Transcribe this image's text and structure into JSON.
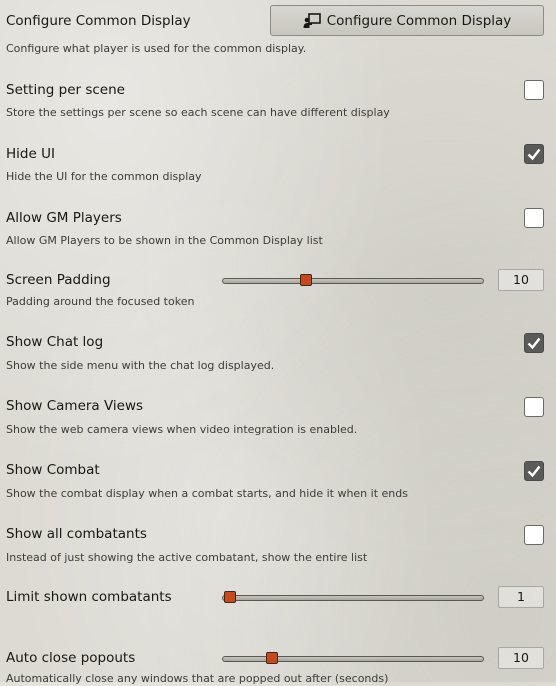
{
  "settings": {
    "configure": {
      "label": "Configure Common Display",
      "button_label": "Configure Common Display",
      "button_icon": "chalkboard-teacher-icon",
      "hint": "Configure what player is used for the common display."
    },
    "setting_per_scene": {
      "label": "Setting per scene",
      "hint": "Store the settings per scene so each scene can have different display",
      "checked": false
    },
    "hide_ui": {
      "label": "Hide UI",
      "hint": "Hide the UI for the common display",
      "checked": true
    },
    "allow_gm_players": {
      "label": "Allow GM Players",
      "hint": "Allow GM Players to be shown in the Common Display list",
      "checked": false
    },
    "screen_padding": {
      "label": "Screen Padding",
      "hint": "Padding around the focused token",
      "value": "10",
      "position": 0.32
    },
    "show_chat_log": {
      "label": "Show Chat log",
      "hint": "Show the side menu with the chat log displayed.",
      "checked": true
    },
    "show_camera_views": {
      "label": "Show Camera Views",
      "hint": "Show the web camera views when video integration is enabled.",
      "checked": false
    },
    "show_combat": {
      "label": "Show Combat",
      "hint": "Show the combat display when a combat starts, and hide it when it ends",
      "checked": true
    },
    "show_all_combatants": {
      "label": "Show all combatants",
      "hint": "Instead of just showing the active combatant, show the entire list",
      "checked": false
    },
    "limit_shown_combatants": {
      "label": "Limit shown combatants",
      "value": "1",
      "position": 0.03
    },
    "auto_close_popouts": {
      "label": "Auto close popouts",
      "hint": "Automatically close any windows that are popped out after (seconds)",
      "value": "10",
      "position": 0.19
    }
  },
  "colors": {
    "accent": "#c9491f",
    "checkbox_checked": "#5a5a58",
    "text": "#191813"
  }
}
